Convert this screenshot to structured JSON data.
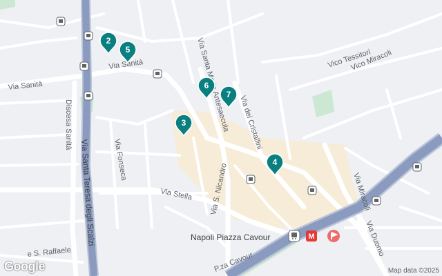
{
  "map": {
    "street_labels": {
      "via_sanita_left": "Via Sanità",
      "via_sanita_right": "Via Sanità",
      "discesa_sanita": "Discesa Sanità",
      "via_santa_teresa": "Via Santa Teresa degli Scalzi",
      "via_fonseca": "Via Fonseca",
      "via_santa_maria_antesaecula": "Via Santa Maria Antesaecula",
      "via_dei_cristallini": "Via dei Cristallini",
      "vico_tessitori": "Vico Tessitori",
      "vico_miracoli": "Vico Miracoli",
      "via_stella": "Via Stella",
      "via_s_nicandro": "Via S. Nicandro",
      "via_miracoli": "Via Miracoli",
      "via_duomo": "Via Duomo",
      "via_s_raffaele": "e S. Raffaele",
      "pza_cavour": "P.za Cavour"
    },
    "station_label": "Napoli Piazza Cavour",
    "metro_badge": "M",
    "markers": [
      "2",
      "5",
      "6",
      "7",
      "3",
      "4"
    ],
    "pin_color": "#0a7f7f",
    "attribution": "Map data ©2025",
    "logo_text": "Google"
  }
}
